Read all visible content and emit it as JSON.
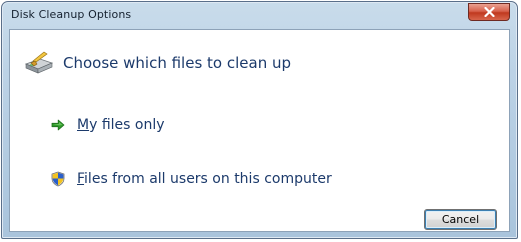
{
  "window": {
    "title": "Disk Cleanup Options",
    "close_icon": "close-icon"
  },
  "dialog": {
    "heading": "Choose which files to clean up",
    "heading_icon": "disk-cleanup-icon",
    "options": [
      {
        "label_prefix": "",
        "mnemonic": "M",
        "label_rest": "y files only",
        "icon": "green-arrow-icon"
      },
      {
        "label_prefix": "",
        "mnemonic": "F",
        "label_rest": "iles from all users on this computer",
        "icon": "uac-shield-icon"
      }
    ],
    "cancel_label": "Cancel"
  },
  "colors": {
    "title_bar": "#bcd2e6",
    "close_button": "#c74a33",
    "link_text": "#1c3a6b",
    "arrow_green": "#2e9b2a"
  }
}
